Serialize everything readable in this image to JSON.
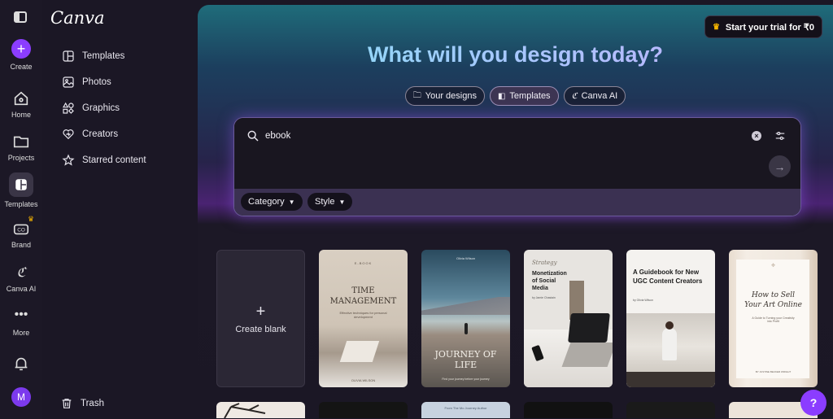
{
  "rail": {
    "create_label": "Create",
    "items": [
      {
        "label": "Home"
      },
      {
        "label": "Projects"
      },
      {
        "label": "Templates"
      },
      {
        "label": "Brand"
      },
      {
        "label": "Canva AI"
      },
      {
        "label": "More"
      }
    ],
    "avatar_initial": "M"
  },
  "sidebar": {
    "logo": "Canva",
    "items": [
      {
        "label": "Templates",
        "icon": "templates-icon"
      },
      {
        "label": "Photos",
        "icon": "photos-icon"
      },
      {
        "label": "Graphics",
        "icon": "graphics-icon"
      },
      {
        "label": "Creators",
        "icon": "creators-icon"
      },
      {
        "label": "Starred content",
        "icon": "star-icon"
      }
    ],
    "trash_label": "Trash"
  },
  "header": {
    "trial_label": "Start your trial for ₹0",
    "headline": "What will you design today?"
  },
  "pills": [
    {
      "label": "Your designs",
      "active": false
    },
    {
      "label": "Templates",
      "active": true
    },
    {
      "label": "Canva AI",
      "active": false
    }
  ],
  "search": {
    "query": "ebook",
    "filters": [
      "Category",
      "Style"
    ]
  },
  "cards": {
    "create_blank_label": "Create blank",
    "templates": [
      {
        "top": "E-BOOK",
        "title": "TIME MANAGEMENT",
        "subtitle": "Effective techniques for personal development",
        "author": "OLIVIA WILSON"
      },
      {
        "top": "Olivia Wilson",
        "title": "JOURNEY OF LIFE",
        "subtitle": "Find your journey before your journey"
      },
      {
        "top": "Strategy",
        "title": "Monetization of Social Media",
        "author": "by Jamie Chastain"
      },
      {
        "title": "A Guidebook for New UGC Content Creators",
        "author": "by Olivia Wilson"
      },
      {
        "title": "How to Sell Your Art Online",
        "subtitle": "A Guide to Turning your Creativity into Profit",
        "author": "BY JUSTINE BECKER WRIGHT"
      }
    ],
    "row2": [
      "",
      "",
      "From The Mo Journey Author",
      "",
      "",
      ""
    ]
  },
  "colors": {
    "accent": "#8b3dff",
    "crown": "#f5b400"
  },
  "help_label": "?"
}
